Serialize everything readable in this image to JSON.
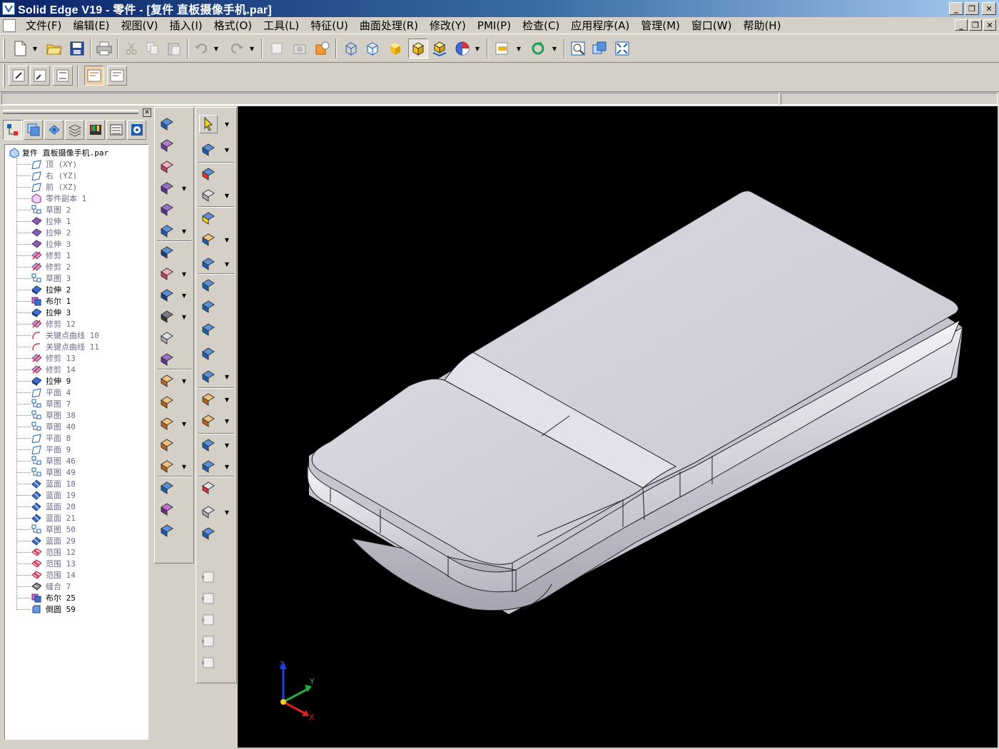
{
  "titlebar": {
    "title": "Solid Edge V19 - 零件 - [复件 直板摄像手机.par]"
  },
  "window_controls": {
    "minimize": "_",
    "restore": "❐",
    "close": "✕"
  },
  "menubar": {
    "items": [
      "文件(F)",
      "编辑(E)",
      "视图(V)",
      "插入(I)",
      "格式(O)",
      "工具(L)",
      "特征(U)",
      "曲面处理(R)",
      "修改(Y)",
      "PMI(P)",
      "检查(C)",
      "应用程序(A)",
      "管理(M)",
      "窗口(W)",
      "帮助(H)"
    ]
  },
  "tree": {
    "root": "复件 直板摄像手机.par",
    "items": [
      {
        "icon": "plane-icon",
        "label": "顶 (XY)",
        "bold": false
      },
      {
        "icon": "plane-icon",
        "label": "右 (YZ)",
        "bold": false
      },
      {
        "icon": "plane-icon",
        "label": "前 (XZ)",
        "bold": false
      },
      {
        "icon": "part-copy-icon",
        "label": "零件副本 1",
        "bold": false
      },
      {
        "icon": "sketch-icon",
        "label": "草图 2",
        "bold": false
      },
      {
        "icon": "extrude-icon",
        "label": "拉伸 1",
        "bold": false
      },
      {
        "icon": "extrude-icon",
        "label": "拉伸 2",
        "bold": false
      },
      {
        "icon": "extrude-icon",
        "label": "拉伸 3",
        "bold": false
      },
      {
        "icon": "trim-icon",
        "label": "修剪 1",
        "bold": false
      },
      {
        "icon": "trim-icon",
        "label": "修剪 2",
        "bold": false
      },
      {
        "icon": "sketch-icon",
        "label": "草图 3",
        "bold": false
      },
      {
        "icon": "solid-extrude-icon",
        "label": "拉伸 2",
        "bold": true
      },
      {
        "icon": "boolean-icon",
        "label": "布尔 1",
        "bold": true
      },
      {
        "icon": "solid-extrude-icon",
        "label": "拉伸 3",
        "bold": true
      },
      {
        "icon": "trim-icon",
        "label": "修剪 12",
        "bold": false
      },
      {
        "icon": "keypoint-curve-icon",
        "label": "关键点曲线 10",
        "bold": false
      },
      {
        "icon": "keypoint-curve-icon",
        "label": "关键点曲线 11",
        "bold": false
      },
      {
        "icon": "trim-icon",
        "label": "修剪 13",
        "bold": false
      },
      {
        "icon": "trim-icon",
        "label": "修剪 14",
        "bold": false
      },
      {
        "icon": "solid-extrude-icon",
        "label": "拉伸 9",
        "bold": true
      },
      {
        "icon": "plane-icon",
        "label": "平面 4",
        "bold": false
      },
      {
        "icon": "sketch-icon",
        "label": "草图 7",
        "bold": false
      },
      {
        "icon": "sketch-icon",
        "label": "草图 38",
        "bold": false
      },
      {
        "icon": "sketch-icon",
        "label": "草图 40",
        "bold": false
      },
      {
        "icon": "plane-icon",
        "label": "平面 8",
        "bold": false
      },
      {
        "icon": "plane-icon",
        "label": "平面 9",
        "bold": false
      },
      {
        "icon": "sketch-icon",
        "label": "草图 46",
        "bold": false
      },
      {
        "icon": "sketch-icon",
        "label": "草图 49",
        "bold": false
      },
      {
        "icon": "bluesurf-icon",
        "label": "蓝面 18",
        "bold": false
      },
      {
        "icon": "bluesurf-icon",
        "label": "蓝面 19",
        "bold": false
      },
      {
        "icon": "bluesurf-icon",
        "label": "蓝面 20",
        "bold": false
      },
      {
        "icon": "bluesurf-icon",
        "label": "蓝面 21",
        "bold": false
      },
      {
        "icon": "sketch-icon",
        "label": "草图 50",
        "bold": false
      },
      {
        "icon": "bluesurf-icon",
        "label": "蓝面 29",
        "bold": false
      },
      {
        "icon": "bounded-icon",
        "label": "范围 12",
        "bold": false
      },
      {
        "icon": "bounded-icon",
        "label": "范围 13",
        "bold": false
      },
      {
        "icon": "bounded-icon",
        "label": "范围 14",
        "bold": false
      },
      {
        "icon": "stitch-icon",
        "label": "缝合 7",
        "bold": false
      },
      {
        "icon": "boolean-icon",
        "label": "布尔 25",
        "bold": true
      },
      {
        "icon": "round-icon",
        "label": "倒圆 59",
        "bold": true
      }
    ]
  },
  "triad": {
    "z": "Z",
    "y": "Y",
    "x": "X"
  },
  "colors": {
    "titlebar_start": "#0a246a",
    "titlebar_end": "#a6caf0",
    "face": "#d4d0c8",
    "viewport": "#000000",
    "model": "#d6d6de"
  }
}
